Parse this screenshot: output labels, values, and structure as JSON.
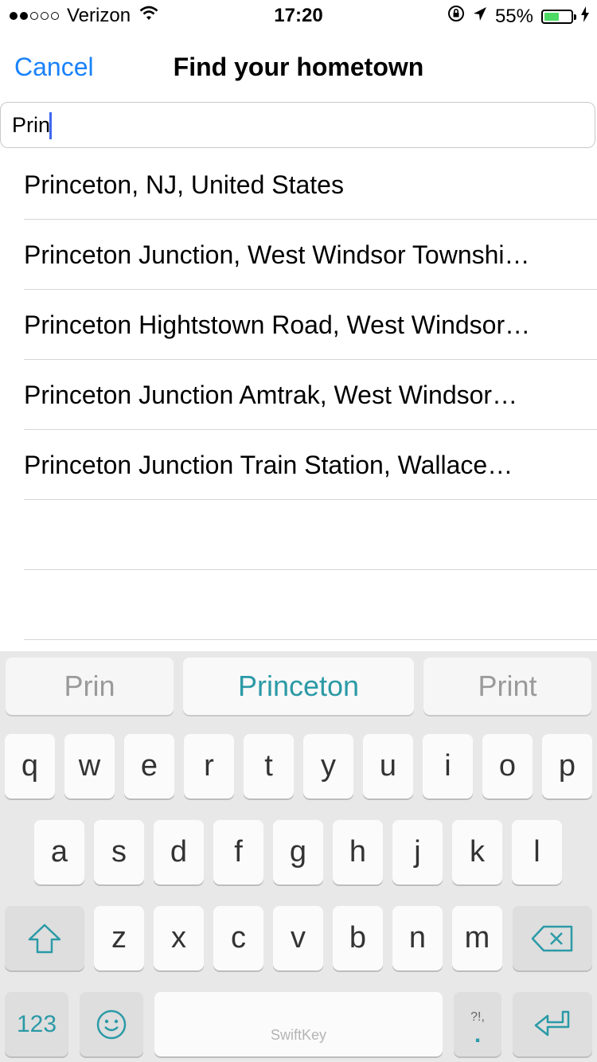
{
  "status_bar": {
    "carrier": "Verizon",
    "time": "17:20",
    "battery": "55%",
    "battery_level": 0.55,
    "signal_bars_filled": 2,
    "signal_bars_total": 5
  },
  "nav": {
    "cancel_label": "Cancel",
    "title": "Find your hometown"
  },
  "search": {
    "value": "Prin"
  },
  "results": [
    "Princeton, NJ, United States",
    "Princeton Junction, West Windsor Townshi…",
    "Princeton Hightstown Road, West Windsor…",
    "Princeton Junction Amtrak, West Windsor…",
    "Princeton Junction Train Station, Wallace…",
    "",
    ""
  ],
  "keyboard": {
    "predictions": [
      "Prin",
      "Princeton",
      "Print"
    ],
    "row1": [
      "q",
      "w",
      "e",
      "r",
      "t",
      "y",
      "u",
      "i",
      "o",
      "p"
    ],
    "row2": [
      "a",
      "s",
      "d",
      "f",
      "g",
      "h",
      "j",
      "k",
      "l"
    ],
    "row3": [
      "z",
      "x",
      "c",
      "v",
      "b",
      "n",
      "m"
    ],
    "numbers_label": "123",
    "space_label": "SwiftKey",
    "punct_label": "?!,",
    "period_label": "."
  },
  "colors": {
    "accent": "#1a82fb",
    "keyboard_accent": "#2b9aa6",
    "battery": "#4cd964",
    "caret": "#3e68f0"
  }
}
